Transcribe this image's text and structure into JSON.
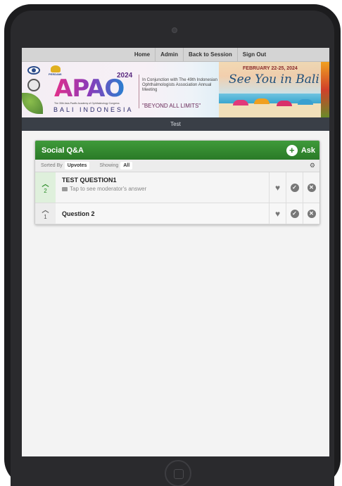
{
  "nav": {
    "home": "Home",
    "admin": "Admin",
    "back": "Back to Session",
    "signout": "Sign Out"
  },
  "banner": {
    "org": "PERDAMI",
    "logo_text": "APAO",
    "year": "2024",
    "congress": "The 39th Asia-Pacific Academy of Ophthalmology Congress",
    "location": "BALI INDONESIA",
    "conjunction": "In Conjunction with The 49th Indonesian Ophthalmologists Association Annual Meeting",
    "slogan": "\"BEYOND ALL LIMITS\"",
    "dates": "FEBRUARY 22-25, 2024",
    "tagline": "See You in Bali"
  },
  "session": {
    "title": "Test"
  },
  "qa": {
    "title": "Social Q&A",
    "ask_label": "Ask",
    "sorted_by_label": "Sorted By",
    "sorted_by_value": "Upvotes",
    "showing_label": "Showing",
    "showing_value": "All",
    "questions": [
      {
        "votes": "2",
        "text": "TEST QUESTION1",
        "hint": "Tap to see moderator's answer"
      },
      {
        "votes": "1",
        "text": "Question 2"
      }
    ]
  },
  "colors": {
    "accent_green": "#2f842b",
    "session_bar": "#3a3f47"
  },
  "icons": [
    "plus-icon",
    "gear-icon",
    "upvote-icon",
    "chat-icon",
    "heart-icon",
    "check-icon",
    "close-icon"
  ]
}
